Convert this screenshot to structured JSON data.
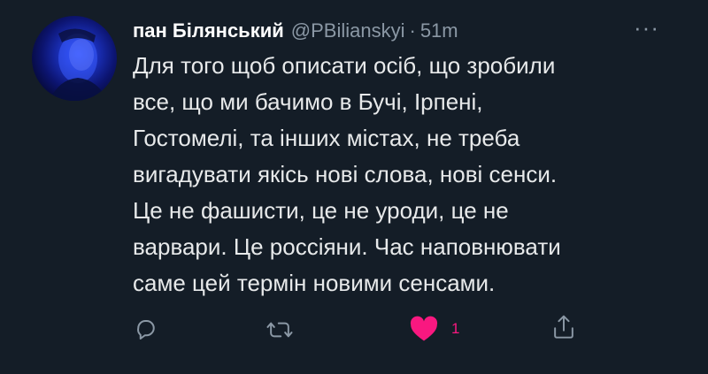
{
  "tweet": {
    "display_name": "пан Білянський",
    "handle": "@PBilianskyi",
    "separator": "·",
    "time": "51m",
    "more_label": "···",
    "text": "Для того щоб описати осіб, що зробили\nвсе, що ми бачимо в Бучі, Ірпені,\nГостомелі, та інших містах, не треба\nвигадувати якісь нові слова, нові сенси.\nЦе не фашисти, це не уроди, це не\nварвари. Це россіяни. Час наповнювати\nсаме цей термін новими сенсами."
  },
  "actions": {
    "reply_icon": "reply-icon",
    "retweet_icon": "retweet-icon",
    "like_icon": "heart-filled-icon",
    "like_count": "1",
    "share_icon": "share-icon"
  },
  "colors": {
    "background": "#141d27",
    "text": "#e7e9ea",
    "muted": "#8b98a5",
    "like": "#f91880",
    "avatar_glow": "#2b4cff"
  }
}
